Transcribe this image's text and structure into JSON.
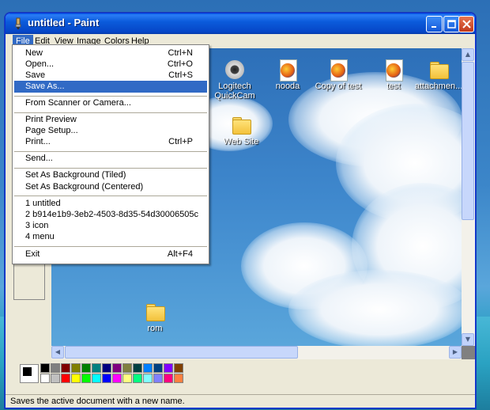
{
  "window": {
    "title": "untitled - Paint",
    "menu": [
      "File",
      "Edit",
      "View",
      "Image",
      "Colors",
      "Help"
    ]
  },
  "file_menu": {
    "items": [
      {
        "label": "New",
        "shortcut": "Ctrl+N"
      },
      {
        "label": "Open...",
        "shortcut": "Ctrl+O"
      },
      {
        "label": "Save",
        "shortcut": "Ctrl+S"
      },
      {
        "label": "Save As...",
        "shortcut": ""
      },
      {
        "label": "From Scanner or Camera...",
        "shortcut": ""
      },
      {
        "label": "Print Preview",
        "shortcut": ""
      },
      {
        "label": "Page Setup...",
        "shortcut": ""
      },
      {
        "label": "Print...",
        "shortcut": "Ctrl+P"
      },
      {
        "label": "Send...",
        "shortcut": ""
      },
      {
        "label": "Set As Background (Tiled)",
        "shortcut": ""
      },
      {
        "label": "Set As Background (Centered)",
        "shortcut": ""
      },
      {
        "label": "1 untitled",
        "shortcut": ""
      },
      {
        "label": "2 b914e1b9-3eb2-4503-8d35-54d30006505c",
        "shortcut": ""
      },
      {
        "label": "3 icon",
        "shortcut": ""
      },
      {
        "label": "4 menu",
        "shortcut": ""
      },
      {
        "label": "Exit",
        "shortcut": "Alt+F4"
      }
    ],
    "highlighted": "Save As..."
  },
  "desktop_icons": [
    {
      "label1": "Logitech",
      "label2": "QuickCam",
      "icon": "webcam-icon"
    },
    {
      "label1": "nooda",
      "label2": "",
      "icon": "firefox-document-icon"
    },
    {
      "label1": "Copy of test",
      "label2": "",
      "icon": "firefox-document-icon"
    },
    {
      "label1": "test",
      "label2": "",
      "icon": "firefox-document-icon"
    },
    {
      "label1": "attachmen...",
      "label2": "",
      "icon": "folder-icon"
    },
    {
      "label1": "Web Site",
      "label2": "",
      "icon": "folder-icon"
    },
    {
      "label1": "rom",
      "label2": "",
      "icon": "folder-icon"
    }
  ],
  "palette": {
    "primary": "#000000",
    "secondary": "#ffffff",
    "colors": [
      "#000000",
      "#808080",
      "#800000",
      "#808000",
      "#008000",
      "#008080",
      "#000080",
      "#800080",
      "#808040",
      "#004040",
      "#0080ff",
      "#004080",
      "#8000ff",
      "#804000",
      "#ffffff",
      "#c0c0c0",
      "#ff0000",
      "#ffff00",
      "#00ff00",
      "#00ffff",
      "#0000ff",
      "#ff00ff",
      "#ffff80",
      "#00ff80",
      "#80ffff",
      "#8080ff",
      "#ff0080",
      "#ff8040"
    ]
  },
  "status": {
    "text": "Saves the active document with a new name."
  }
}
